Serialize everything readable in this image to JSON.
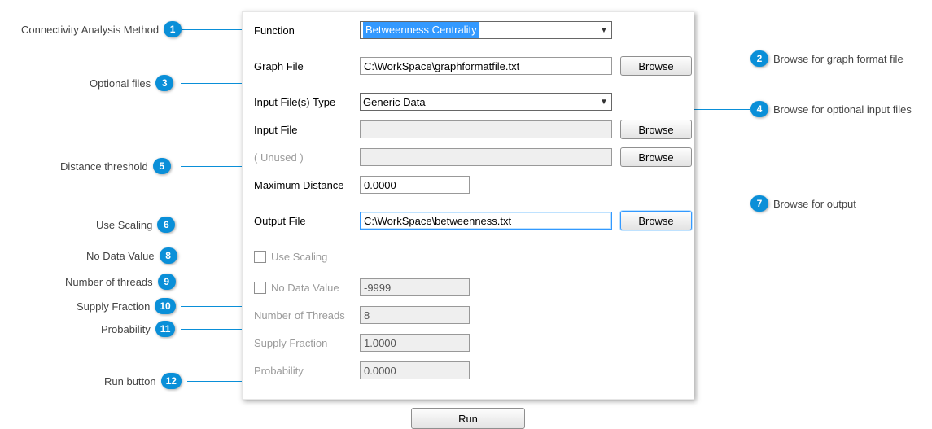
{
  "form": {
    "function_label": "Function",
    "function_value": "Betweenness Centrality",
    "graphfile_label": "Graph File",
    "graphfile_value": "C:\\WorkSpace\\graphformatfile.txt",
    "inputtype_label": "Input File(s) Type",
    "inputtype_value": "Generic Data",
    "inputfile_label": "Input File",
    "inputfile_value": "",
    "unused_label": "( Unused )",
    "unused_value": "",
    "maxdist_label": "Maximum Distance",
    "maxdist_value": "0.0000",
    "output_label": "Output File",
    "output_value": "C:\\WorkSpace\\betweenness.txt",
    "usescaling_label": "Use Scaling",
    "nodata_label": "No Data Value",
    "nodata_value": "-9999",
    "threads_label": "Number of Threads",
    "threads_value": "8",
    "supply_label": "Supply Fraction",
    "supply_value": "1.0000",
    "prob_label": "Probability",
    "prob_value": "0.0000",
    "browse_label": "Browse",
    "run_label": "Run"
  },
  "callouts": {
    "c1": {
      "n": "1",
      "text": "Connectivity Analysis Method"
    },
    "c2": {
      "n": "2",
      "text": "Browse for graph format file"
    },
    "c3": {
      "n": "3",
      "text": "Optional files"
    },
    "c4": {
      "n": "4",
      "text": "Browse for optional input files"
    },
    "c5": {
      "n": "5",
      "text": "Distance threshold"
    },
    "c6": {
      "n": "6",
      "text": "Use Scaling"
    },
    "c7": {
      "n": "7",
      "text": "Browse for output"
    },
    "c8": {
      "n": "8",
      "text": "No Data Value"
    },
    "c9": {
      "n": "9",
      "text": "Number of threads"
    },
    "c10": {
      "n": "10",
      "text": "Supply Fraction"
    },
    "c11": {
      "n": "11",
      "text": "Probability"
    },
    "c12": {
      "n": "12",
      "text": "Run button"
    }
  }
}
